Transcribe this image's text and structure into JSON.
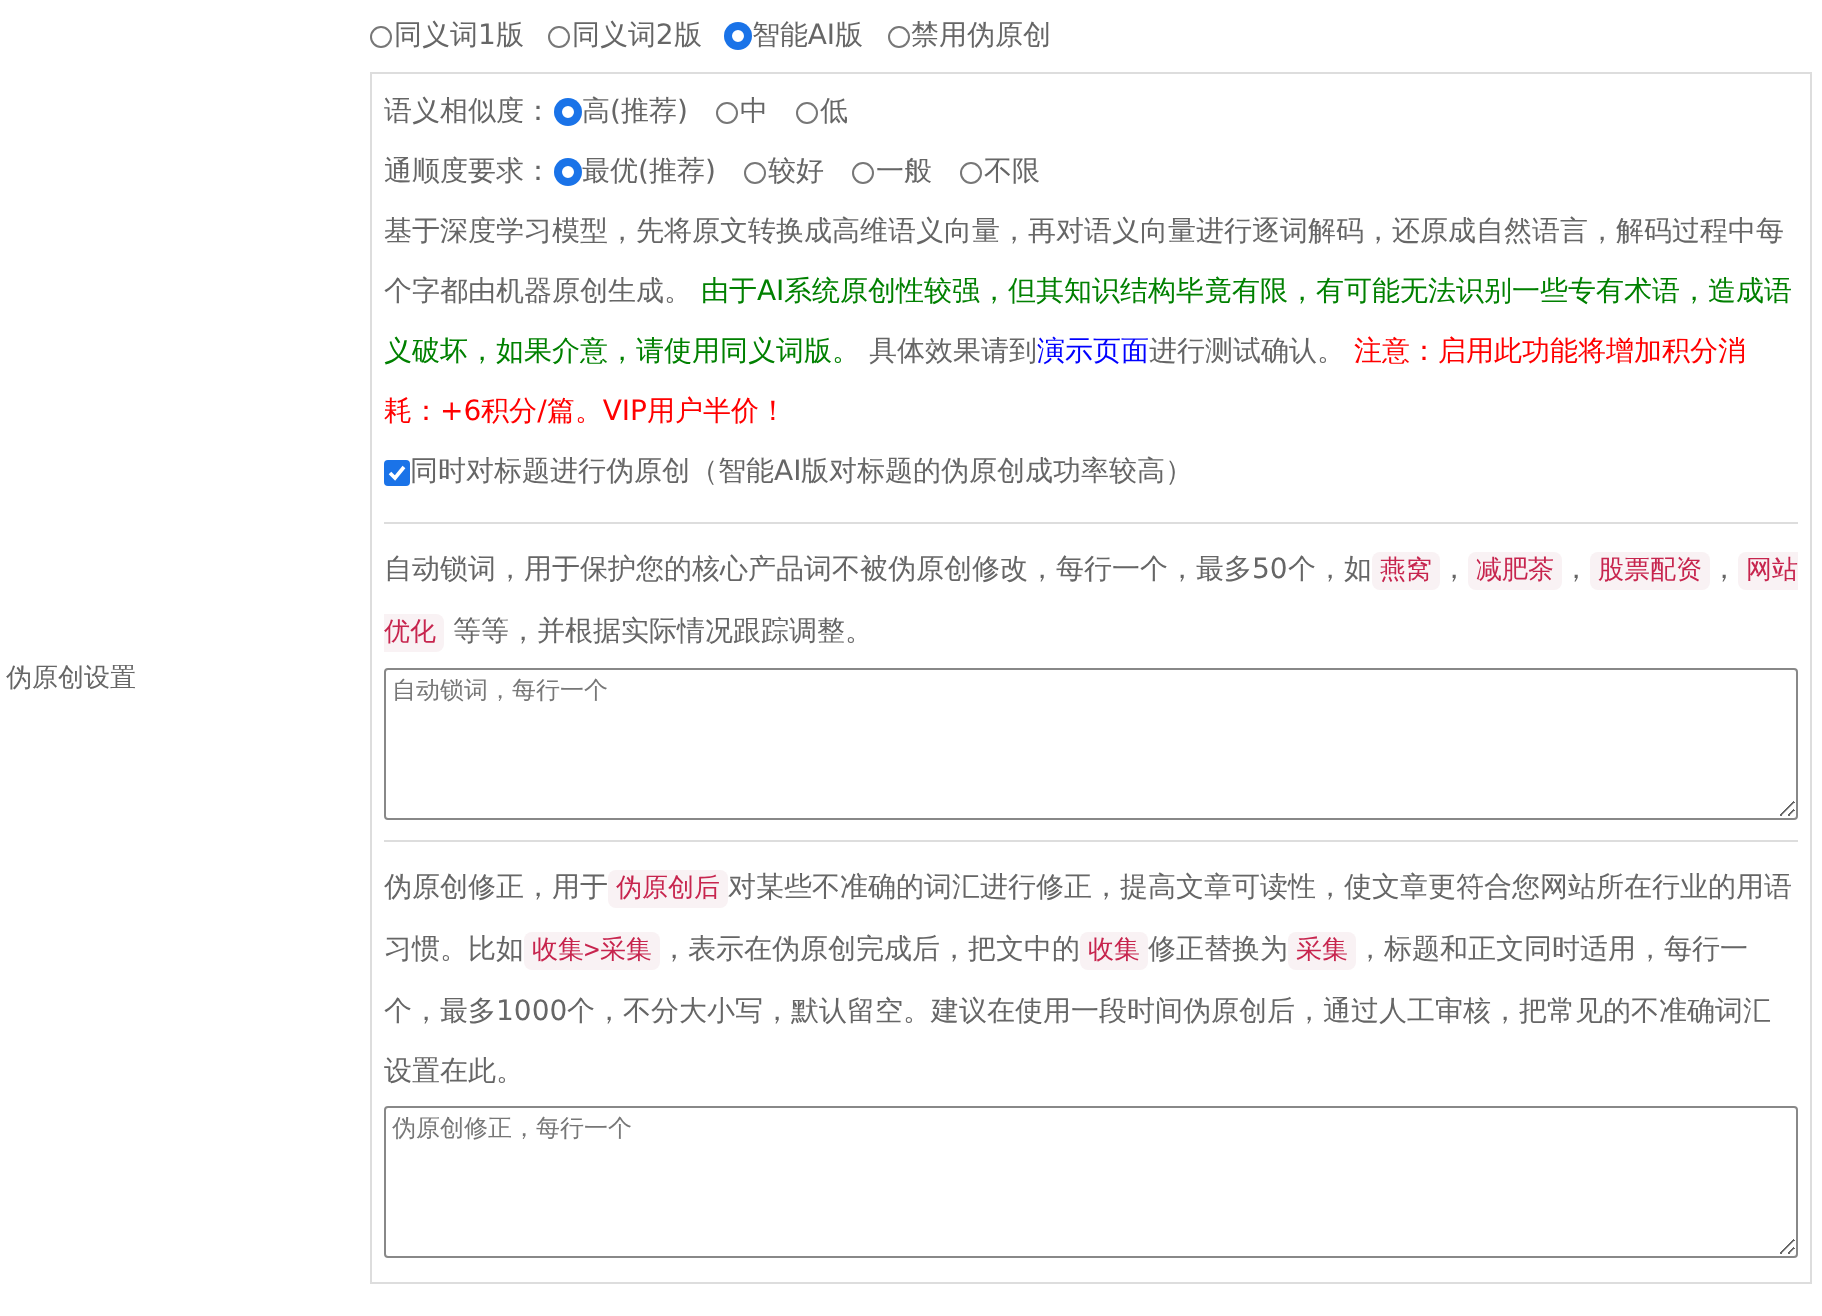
{
  "mode_options": [
    {
      "label": "同义词1版",
      "selected": false
    },
    {
      "label": "同义词2版",
      "selected": false
    },
    {
      "label": "智能AI版",
      "selected": true
    },
    {
      "label": "禁用伪原创",
      "selected": false
    }
  ],
  "side_label": "伪原创设置",
  "similarity": {
    "label": "语义相似度：",
    "options": [
      {
        "label": "高(推荐)",
        "selected": true
      },
      {
        "label": "中",
        "selected": false
      },
      {
        "label": "低",
        "selected": false
      }
    ]
  },
  "fluency": {
    "label": "通顺度要求：",
    "options": [
      {
        "label": "最优(推荐)",
        "selected": true
      },
      {
        "label": "较好",
        "selected": false
      },
      {
        "label": "一般",
        "selected": false
      },
      {
        "label": "不限",
        "selected": false
      }
    ]
  },
  "description": [
    {
      "kind": "text",
      "text": "基于深度学习模型，先将原文转换成高维语义向量，再对语义向量进行逐词解码，还原成自然语言，解码过程中每个字都由机器原创生成。 "
    },
    {
      "kind": "green",
      "text": "由于AI系统原创性较强，但其知识结构毕竟有限，有可能无法识别一些专有术语，造成语义破坏，如果介意，请使用同义词版。"
    },
    {
      "kind": "text",
      "text": " 具体效果请到"
    },
    {
      "kind": "link",
      "text": "演示页面"
    },
    {
      "kind": "text",
      "text": "进行测试确认。 "
    },
    {
      "kind": "red",
      "text": "注意：启用此功能将增加积分消耗：+6积分/篇。VIP用户半价！"
    }
  ],
  "title_option": {
    "label": "同时对标题进行伪原创（智能AI版对标题的伪原创成功率较高）",
    "checked": true
  },
  "lock_words": {
    "description": [
      {
        "kind": "text",
        "text": "自动锁词，用于保护您的核心产品词不被伪原创修改，每行一个，最多50个，如"
      },
      {
        "kind": "code",
        "text": "燕窝"
      },
      {
        "kind": "text",
        "text": "，"
      },
      {
        "kind": "code",
        "text": "减肥茶"
      },
      {
        "kind": "text",
        "text": "，"
      },
      {
        "kind": "code",
        "text": "股票配资"
      },
      {
        "kind": "text",
        "text": "，"
      },
      {
        "kind": "code",
        "text": "网站优化"
      },
      {
        "kind": "text",
        "text": " 等等，并根据实际情况跟踪调整。"
      }
    ],
    "placeholder": "自动锁词，每行一个"
  },
  "corrections": {
    "description": [
      {
        "kind": "text",
        "text": "伪原创修正，用于"
      },
      {
        "kind": "code",
        "text": "伪原创后"
      },
      {
        "kind": "text",
        "text": "对某些不准确的词汇进行修正，提高文章可读性，使文章更符合您网站所在行业的用语习惯。比如"
      },
      {
        "kind": "code",
        "text": "收集>采集"
      },
      {
        "kind": "text",
        "text": "，表示在伪原创完成后，把文中的"
      },
      {
        "kind": "code",
        "text": "收集"
      },
      {
        "kind": "text",
        "text": "修正替换为"
      },
      {
        "kind": "code",
        "text": "采集"
      },
      {
        "kind": "text",
        "text": "，标题和正文同时适用，每行一个，最多1000个，不分大小写，默认留空。建议在使用一段时间伪原创后，通过人工审核，把常见的不准确词汇设置在此。"
      }
    ],
    "placeholder": "伪原创修正，每行一个"
  }
}
